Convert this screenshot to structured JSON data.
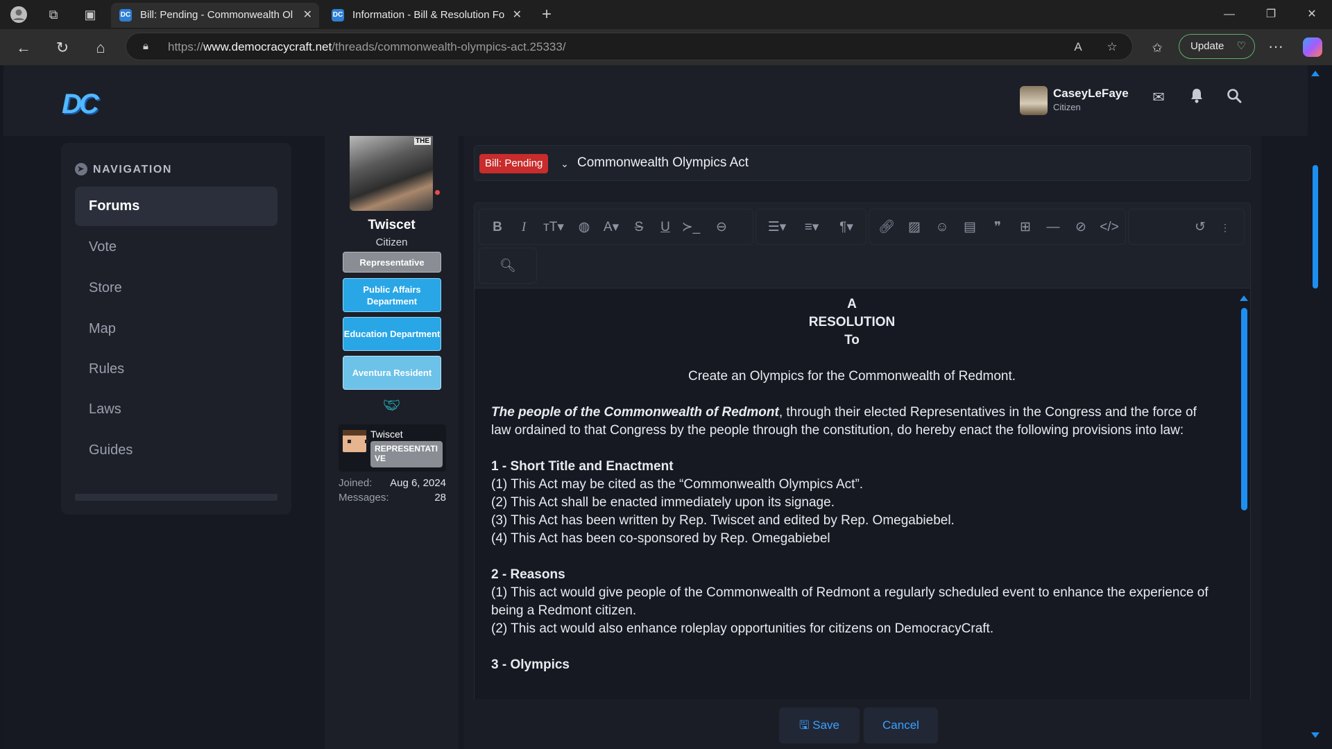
{
  "browser": {
    "tabs": [
      {
        "title": "Bill: Pending - Commonwealth Ol",
        "active": true
      },
      {
        "title": "Information - Bill & Resolution Fo",
        "active": false
      }
    ],
    "url_prefix": "https://",
    "url_host": "www.democracycraft.net",
    "url_path": "/threads/commonwealth-olympics-act.25333/",
    "update_label": "Update",
    "accent_update": "#5fae6a"
  },
  "header": {
    "logo_text": "DC",
    "user_name": "CaseyLeFaye",
    "user_role": "Citizen"
  },
  "sidebar": {
    "heading": "NAVIGATION",
    "items": [
      {
        "label": "Forums",
        "active": true
      },
      {
        "label": "Vote"
      },
      {
        "label": "Store"
      },
      {
        "label": "Map"
      },
      {
        "label": "Rules"
      },
      {
        "label": "Laws"
      },
      {
        "label": "Guides"
      }
    ]
  },
  "poster": {
    "name": "Twiscet",
    "title": "Citizen",
    "avatar_tag": "THE",
    "badges": [
      {
        "label": "Representative",
        "color": "#8a8d93"
      },
      {
        "label": "Public Affairs Department",
        "color": "#29a6e6"
      },
      {
        "label": "Education Department",
        "color": "#29a6e6"
      },
      {
        "label": "Aventura Resident",
        "color": "#6cc2e8"
      }
    ],
    "mini_name": "Twiscet",
    "mini_badge": "REPRESENTATIVE",
    "joined_label": "Joined:",
    "joined_value": "Aug 6, 2024",
    "messages_label": "Messages:",
    "messages_value": "28"
  },
  "editor": {
    "prefix": "Bill: Pending",
    "prefix_color": "#c82c2c",
    "title": "Commonwealth Olympics Act",
    "content": {
      "heading": [
        "A",
        "RESOLUTION",
        "To"
      ],
      "subtitle": "Create an Olympics for the Commonwealth of Redmont.",
      "preamble_em": "The people of the Commonwealth of Redmont",
      "preamble_rest": ", through their elected Representatives in the Congress and the force of law ordained to that Congress by the people through the constitution, do hereby enact the following provisions into law:",
      "sections": [
        {
          "heading": "1 - Short Title and Enactment",
          "lines": [
            "(1) This Act may be cited as the “Commonwealth Olympics Act”.",
            "(2) This Act shall be enacted immediately upon its signage.",
            "(3) This Act has been written by Rep. Twiscet and edited by Rep. Omegabiebel.",
            "(4) This Act has been co-sponsored by Rep. Omegabiebel"
          ]
        },
        {
          "heading": "2 - Reasons",
          "lines": [
            "(1) This act would give people of the Commonwealth of Redmont a regularly scheduled event to enhance the experience of being a Redmont citizen.",
            "(2) This act would also enhance roleplay opportunities for citizens on DemocracyCraft."
          ]
        },
        {
          "heading": "3 - Olympics",
          "lines": []
        }
      ]
    },
    "save_label": "Save",
    "cancel_label": "Cancel",
    "accent": "#3aa2ff"
  }
}
